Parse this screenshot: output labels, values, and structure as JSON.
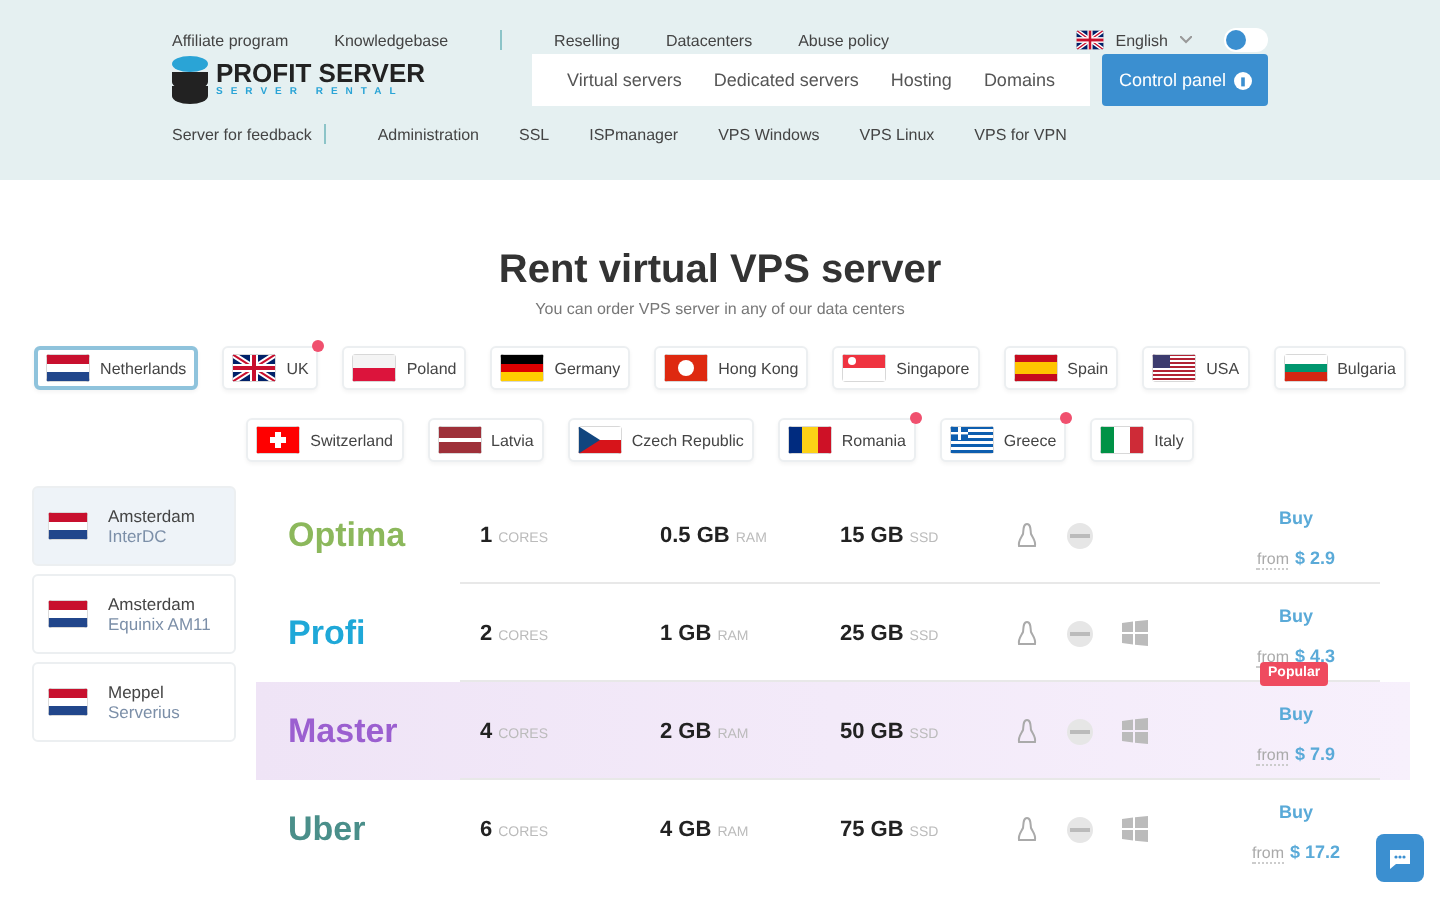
{
  "header": {
    "top_links": [
      "Affiliate program",
      "Knowledgebase",
      "Reselling",
      "Datacenters",
      "Abuse policy"
    ],
    "language": "English",
    "dark_mode": false,
    "logo": {
      "name": "PROFIT SERVER",
      "tagline": "SERVER RENTAL"
    },
    "nav": [
      "Virtual servers",
      "Dedicated servers",
      "Hosting",
      "Domains"
    ],
    "control_panel": "Control panel",
    "bottom_links": [
      "Server for feedback",
      "Administration",
      "SSL",
      "ISPmanager",
      "VPS Windows",
      "VPS Linux",
      "VPS for VPN"
    ]
  },
  "title": "Rent virtual VPS server",
  "subtitle": "You can order VPS server in any of our data centers",
  "countries": [
    {
      "label": "Netherlands",
      "selected": true,
      "new": false
    },
    {
      "label": "UK",
      "selected": false,
      "new": true
    },
    {
      "label": "Poland",
      "selected": false,
      "new": false
    },
    {
      "label": "Germany",
      "selected": false,
      "new": false
    },
    {
      "label": "Hong Kong",
      "selected": false,
      "new": false
    },
    {
      "label": "Singapore",
      "selected": false,
      "new": false
    },
    {
      "label": "Spain",
      "selected": false,
      "new": false
    },
    {
      "label": "USA",
      "selected": false,
      "new": false
    },
    {
      "label": "Bulgaria",
      "selected": false,
      "new": false
    },
    {
      "label": "Switzerland",
      "selected": false,
      "new": false
    },
    {
      "label": "Latvia",
      "selected": false,
      "new": false
    },
    {
      "label": "Czech Republic",
      "selected": false,
      "new": false
    },
    {
      "label": "Romania",
      "selected": false,
      "new": true
    },
    {
      "label": "Greece",
      "selected": false,
      "new": true
    },
    {
      "label": "Italy",
      "selected": false,
      "new": false
    }
  ],
  "locations": [
    {
      "city": "Amsterdam",
      "provider": "InterDC",
      "selected": true
    },
    {
      "city": "Amsterdam",
      "provider": "Equinix AM11",
      "selected": false
    },
    {
      "city": "Meppel",
      "provider": "Serverius",
      "selected": false
    }
  ],
  "plans": [
    {
      "name": "Optima",
      "color": "#8cb85c",
      "cores": "1",
      "cores_unit": "CORES",
      "ram": "0.5 GB",
      "ram_unit": "RAM",
      "ssd": "15 GB",
      "ssd_unit": "SSD",
      "windows": false,
      "highlighted": false,
      "buy": "Buy",
      "from": "from",
      "price": "$ 2.9"
    },
    {
      "name": "Profi",
      "color": "#1fa8d8",
      "cores": "2",
      "cores_unit": "CORES",
      "ram": "1 GB",
      "ram_unit": "RAM",
      "ssd": "25 GB",
      "ssd_unit": "SSD",
      "windows": true,
      "highlighted": false,
      "buy": "Buy",
      "from": "from",
      "price": "$ 4.3"
    },
    {
      "name": "Master",
      "color": "#9b5fd0",
      "cores": "4",
      "cores_unit": "CORES",
      "ram": "2 GB",
      "ram_unit": "RAM",
      "ssd": "50 GB",
      "ssd_unit": "SSD",
      "windows": true,
      "highlighted": true,
      "badge": "Popular",
      "buy": "Buy",
      "from": "from",
      "price": "$ 7.9"
    },
    {
      "name": "Uber",
      "color": "#4a8f8a",
      "cores": "6",
      "cores_unit": "CORES",
      "ram": "4 GB",
      "ram_unit": "RAM",
      "ssd": "75 GB",
      "ssd_unit": "SSD",
      "windows": true,
      "highlighted": false,
      "buy": "Buy",
      "from": "from",
      "price": "$ 17.2"
    }
  ]
}
